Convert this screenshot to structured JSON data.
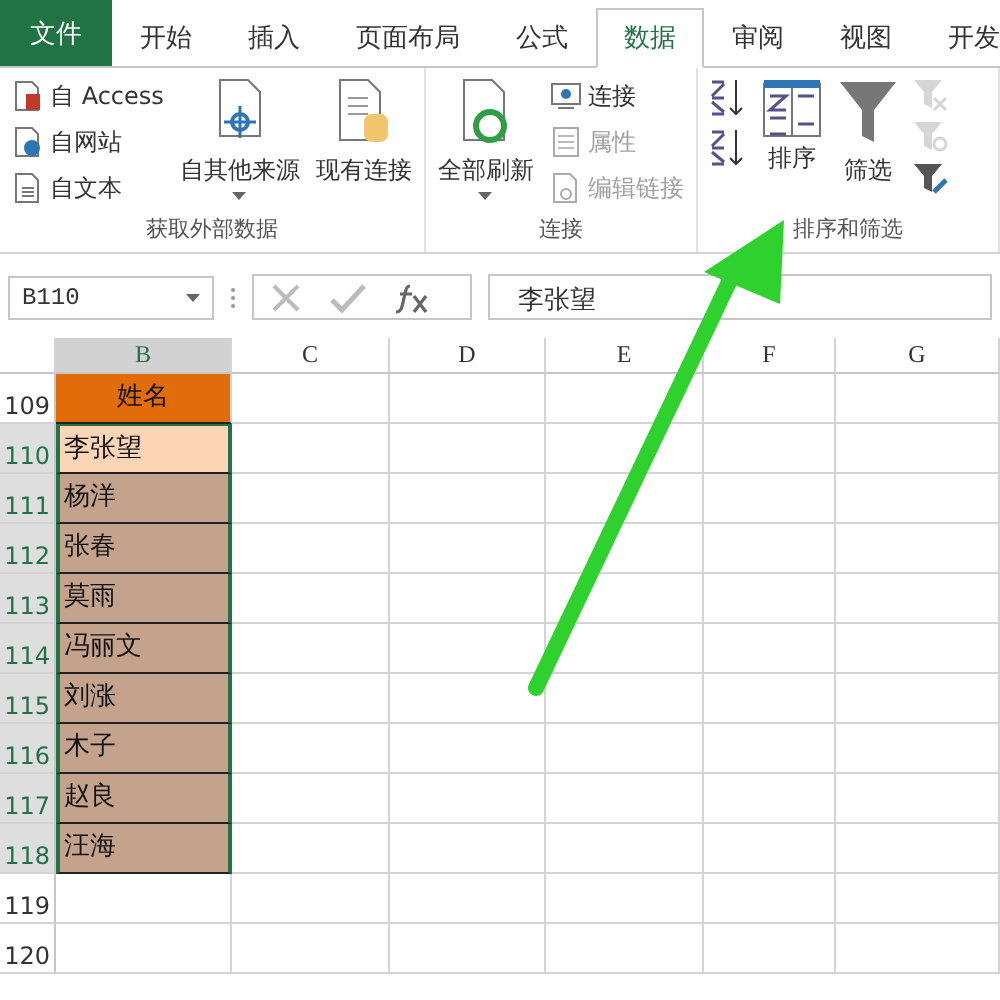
{
  "tabs": [
    {
      "label": "文件",
      "kind": "file",
      "selected": false
    },
    {
      "label": "开始",
      "kind": "tab",
      "selected": false
    },
    {
      "label": "插入",
      "kind": "tab",
      "selected": false
    },
    {
      "label": "页面布局",
      "kind": "tab",
      "selected": false
    },
    {
      "label": "公式",
      "kind": "tab",
      "selected": false
    },
    {
      "label": "数据",
      "kind": "tab",
      "selected": true
    },
    {
      "label": "审阅",
      "kind": "tab",
      "selected": false
    },
    {
      "label": "视图",
      "kind": "tab",
      "selected": false
    },
    {
      "label": "开发",
      "kind": "tab",
      "selected": false
    }
  ],
  "ribbon": {
    "groups": [
      {
        "title": "获取外部数据",
        "items": [
          {
            "kind": "small",
            "label": "自 Access",
            "disabled": false
          },
          {
            "kind": "small",
            "label": "自网站",
            "disabled": false
          },
          {
            "kind": "small",
            "label": "自文本",
            "disabled": false
          },
          {
            "kind": "large",
            "label": "自其他来源",
            "disabled": false,
            "dropdown": true
          },
          {
            "kind": "large",
            "label": "现有连接",
            "disabled": false,
            "dropdown": false
          }
        ]
      },
      {
        "title": "连接",
        "items": [
          {
            "kind": "large",
            "label": "全部刷新",
            "disabled": false,
            "dropdown": true
          },
          {
            "kind": "small",
            "label": "连接",
            "disabled": false
          },
          {
            "kind": "small",
            "label": "属性",
            "disabled": true
          },
          {
            "kind": "small",
            "label": "编辑链接",
            "disabled": true
          }
        ]
      },
      {
        "title": "排序和筛选",
        "items": [
          {
            "kind": "icon",
            "disabled": false
          },
          {
            "kind": "icon",
            "disabled": false
          },
          {
            "kind": "large",
            "label": "排序",
            "disabled": false,
            "dropdown": false
          },
          {
            "kind": "large",
            "label": "筛选",
            "disabled": false,
            "dropdown": false
          },
          {
            "kind": "icon",
            "disabled": true
          },
          {
            "kind": "icon",
            "disabled": true
          },
          {
            "kind": "icon",
            "disabled": false
          }
        ]
      }
    ]
  },
  "formula_bar": {
    "name_box": "B110",
    "value": "李张望"
  },
  "sheet": {
    "columns": [
      {
        "label": "B",
        "selected": true
      },
      {
        "label": "C",
        "selected": false
      },
      {
        "label": "D",
        "selected": false
      },
      {
        "label": "E",
        "selected": false
      },
      {
        "label": "F",
        "selected": false
      },
      {
        "label": "G",
        "selected": false
      }
    ],
    "rows": [
      {
        "number": "109",
        "selected": false,
        "kind": "header",
        "cell": "姓名"
      },
      {
        "number": "110",
        "selected": true,
        "kind": "active",
        "cell": "李张望"
      },
      {
        "number": "111",
        "selected": true,
        "kind": "data",
        "cell": "杨洋"
      },
      {
        "number": "112",
        "selected": true,
        "kind": "data",
        "cell": "张春"
      },
      {
        "number": "113",
        "selected": true,
        "kind": "data",
        "cell": "莫雨"
      },
      {
        "number": "114",
        "selected": true,
        "kind": "data",
        "cell": "冯丽文"
      },
      {
        "number": "115",
        "selected": true,
        "kind": "data",
        "cell": "刘涨"
      },
      {
        "number": "116",
        "selected": true,
        "kind": "data",
        "cell": "木子"
      },
      {
        "number": "117",
        "selected": true,
        "kind": "data",
        "cell": "赵良"
      },
      {
        "number": "118",
        "selected": true,
        "kind": "data",
        "cell": "汪海"
      },
      {
        "number": "119",
        "selected": false,
        "kind": "empty"
      },
      {
        "number": "120",
        "selected": false,
        "kind": "empty"
      }
    ]
  }
}
